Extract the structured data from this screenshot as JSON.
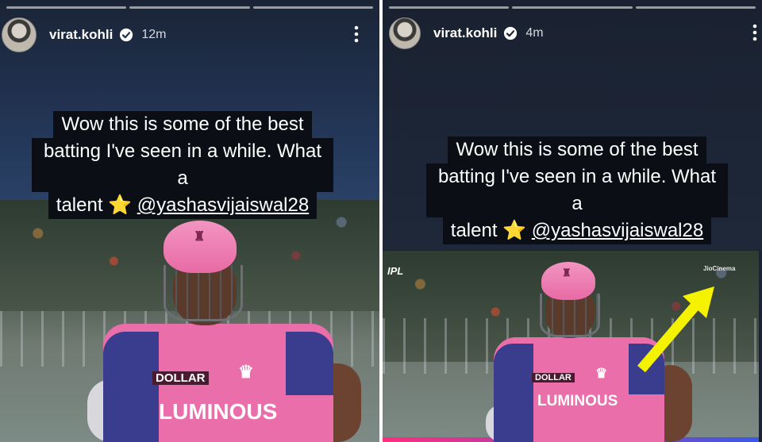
{
  "stories": [
    {
      "username": "virat.kohli",
      "time": "12m",
      "caption_lines": [
        "Wow this is some of the best",
        "batting I've seen in a while. What a",
        "talent"
      ],
      "mention": "@yashasvijaiswal28",
      "star": "⭐",
      "menu": "⋮",
      "jersey": {
        "sponsor_top": "DOLLAR",
        "sponsor_main": "LUMINOUS"
      }
    },
    {
      "username": "virat.kohli",
      "time": "4m",
      "caption_lines": [
        "Wow this is some of the best",
        "batting I've seen in a while. What a",
        "talent"
      ],
      "mention": "@yashasvijaiswal28",
      "star": "⭐",
      "menu": "⋮",
      "jersey": {
        "sponsor_top": "DOLLAR",
        "sponsor_main": "LUMINOUS"
      },
      "broadcast": {
        "ipl_logo": "IPL",
        "jiocinema": "JioCinema"
      }
    }
  ],
  "colors": {
    "accent_arrow": "#f5f200",
    "helmet": "#ee7fb5",
    "jersey": "#ea6ea9",
    "verified": "#ffffff"
  },
  "icons": [
    "verified-badge-icon",
    "more-options-icon",
    "star-icon",
    "arrow-icon"
  ]
}
